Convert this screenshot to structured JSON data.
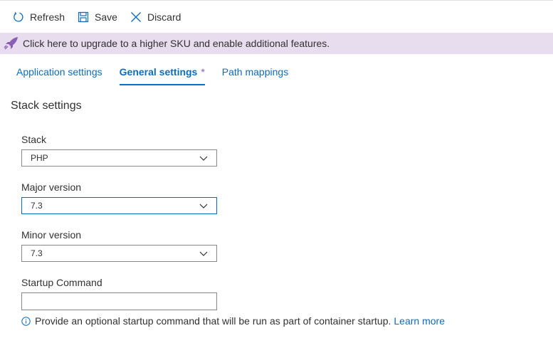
{
  "toolbar": {
    "refresh_label": "Refresh",
    "save_label": "Save",
    "discard_label": "Discard"
  },
  "banner": {
    "text": "Click here to upgrade to a higher SKU and enable additional features."
  },
  "tabs": [
    {
      "label": "Application settings",
      "active": false
    },
    {
      "label": "General settings",
      "active": true,
      "modified_marker": "*"
    },
    {
      "label": "Path mappings",
      "active": false
    }
  ],
  "section": {
    "title": "Stack settings"
  },
  "fields": {
    "stack": {
      "label": "Stack",
      "value": "PHP"
    },
    "major_version": {
      "label": "Major version",
      "value": "7.3"
    },
    "minor_version": {
      "label": "Minor version",
      "value": "7.3"
    },
    "startup_command": {
      "label": "Startup Command",
      "value": ""
    }
  },
  "info": {
    "text": "Provide an optional startup command that will be run as part of container startup.",
    "link": "Learn more"
  },
  "colors": {
    "accent": "#0f6cbd",
    "banner_bg": "#e8dcef",
    "rocket": "#8a5fb5"
  }
}
